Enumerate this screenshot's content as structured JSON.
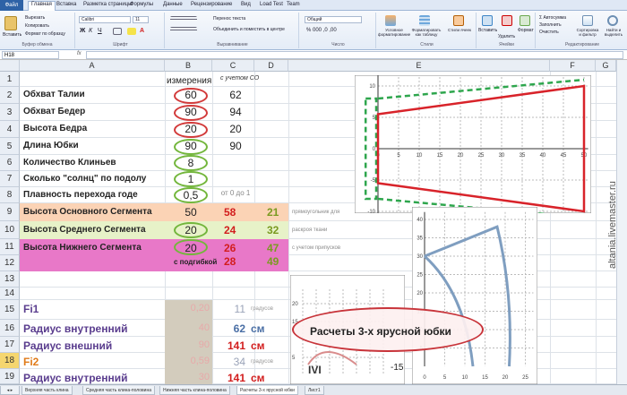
{
  "ribbon": {
    "file_tab": "Файл",
    "tabs": [
      "Главная",
      "Вставка",
      "Разметка страницы",
      "Формулы",
      "Данные",
      "Рецензирование",
      "Вид",
      "Load Test",
      "Team"
    ],
    "clipboard": {
      "paste": "Вставить",
      "cut": "Вырезать",
      "copy": "Копировать",
      "format": "Формат по образцу",
      "group": "Буфер обмена"
    },
    "font": {
      "name": "Calibri",
      "size": "11",
      "group": "Шрифт"
    },
    "alignment": {
      "wrap": "Перенос текста",
      "merge": "Объединить и поместить в центре",
      "group": "Выравнивание"
    },
    "number": {
      "format": "Общий",
      "group": "Число"
    },
    "styles": {
      "conditional": "Условное форматирование",
      "as_table": "Форматировать как таблицу",
      "cell_styles": "Стили ячеек",
      "group": "Стили"
    },
    "cells": {
      "insert": "Вставить",
      "delete": "Удалить",
      "format": "Формат",
      "group": "Ячейки"
    },
    "editing": {
      "autosum": "Автосумма",
      "fill": "Заполнить",
      "clear": "Очистить",
      "sort": "Сортировка и фильтр",
      "find": "Найти и выделить",
      "group": "Редактирование"
    }
  },
  "formula_bar": {
    "cell_ref": "H18",
    "fx": "fx",
    "value": ""
  },
  "columns": [
    "A",
    "B",
    "C",
    "D",
    "E",
    "F",
    "G"
  ],
  "rows": [
    "1",
    "2",
    "3",
    "4",
    "5",
    "6",
    "7",
    "8",
    "9",
    "10",
    "11",
    "12",
    "13",
    "14",
    "15",
    "16",
    "17",
    "18",
    "19"
  ],
  "selected_row": "18",
  "headers_row1": {
    "b": "измерения",
    "c": "с учетом СО"
  },
  "params": [
    {
      "label": "Обхват Талии",
      "b": "60",
      "c": "62"
    },
    {
      "label": "Обхват Бедер",
      "b": "90",
      "c": "94"
    },
    {
      "label": "Высота Бедра",
      "b": "20",
      "c": "20"
    },
    {
      "label": "Длина Юбки",
      "b": "90",
      "c": "90"
    },
    {
      "label": "Количество Клиньев",
      "b": "8",
      "c": ""
    },
    {
      "label": "Сколько \"солнц\" по подолу",
      "b": "1",
      "c": ""
    },
    {
      "label": "Плавность перехода годе",
      "b": "0,5",
      "c": "от 0 до 1"
    }
  ],
  "segments": [
    {
      "label": "Высота Основного Сегмента",
      "b": "50",
      "c": "58",
      "d": "21",
      "note": "прямоугольник для"
    },
    {
      "label": "Высота Среднего Сегмента",
      "b": "20",
      "c": "24",
      "d": "32",
      "note": "раскроя ткани"
    },
    {
      "label": "Высота Нижнего Сегмента",
      "b": "20",
      "c": "26",
      "d": "47",
      "note": "с учетом припусков"
    }
  ],
  "row12": {
    "label": "с подгибкой",
    "c": "28",
    "d": "49"
  },
  "calc": [
    {
      "label": "Fi1",
      "b": "0,20",
      "c": "11",
      "unit": "градусов"
    },
    {
      "label": "Радиус внутренний",
      "b": "40",
      "c": "62",
      "unit": "см"
    },
    {
      "label": "Радиус внешний",
      "b": "90",
      "c": "141",
      "unit": "см"
    },
    {
      "label": "Fi2",
      "b": "0,59",
      "c": "34",
      "unit": "градусов"
    },
    {
      "label": "Радиус внутренний",
      "b": "30",
      "c": "141",
      "unit": "см"
    }
  ],
  "chart1": {
    "x_ticks": [
      "0",
      "5",
      "10",
      "15",
      "20",
      "25",
      "30",
      "35",
      "40",
      "45",
      "50"
    ],
    "y_ticks": [
      "10",
      "5",
      "0",
      "-5",
      "-10"
    ]
  },
  "chart2": {
    "x_ticks": [
      "0",
      "5",
      "10",
      "15",
      "20",
      "25"
    ],
    "y_ticks": [
      "40",
      "35",
      "30",
      "25",
      "20",
      "15",
      "10",
      "5"
    ]
  },
  "chart3": {
    "x_ticks": [
      "5",
      "15",
      "20",
      "25"
    ],
    "y_ticks": [
      "20",
      "15",
      "5"
    ],
    "partial_label": "-15",
    "partial_label2": "IVI"
  },
  "callout": "Расчеты 3-х ярусной юбки",
  "sheets": [
    "Верхняя часть клина",
    "Средняя часть клина-половина",
    "Нижняя часть клина-половина",
    "Расчеты 3-х ярусной юбки",
    "Лист1"
  ],
  "active_sheet": 3,
  "watermark": "altania.livemaster.ru",
  "colors": {
    "red": "#d23a3a",
    "green": "#73b63c",
    "peach": "#fbd3b5",
    "lime": "#e7f2c8",
    "pink": "#e878c8",
    "line": "#7f9ec0",
    "dash": "#2ea64d"
  }
}
